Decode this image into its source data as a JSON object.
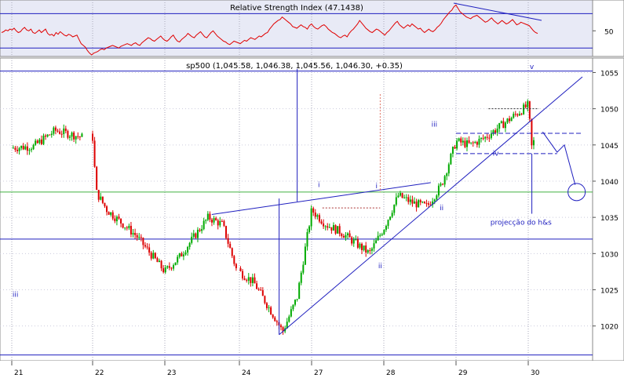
{
  "chart_data": [
    {
      "type": "line",
      "title": "Relative Strength Index (47.1438)",
      "ylim": [
        22,
        84
      ],
      "yticks": [
        50
      ],
      "hlines": [
        70,
        30
      ],
      "grid": true,
      "colors": {
        "line": "#e00000",
        "bg": "#e8eaf6",
        "hline": "#1f1fbf"
      },
      "series": [
        {
          "values": [
            48,
            49,
            51,
            50,
            52,
            51,
            53,
            50,
            48,
            49,
            52,
            54,
            51,
            50,
            52,
            48,
            47,
            49,
            51,
            48,
            50,
            52,
            47,
            45,
            46,
            44,
            48,
            46,
            49,
            47,
            45,
            44,
            46,
            45,
            43,
            44,
            45,
            40,
            35,
            33,
            31,
            27,
            24,
            22,
            24,
            25,
            26,
            28,
            29,
            28,
            30,
            31,
            32,
            33,
            32,
            31,
            30,
            32,
            33,
            34,
            35,
            34,
            33,
            35,
            36,
            34,
            33,
            36,
            38,
            40,
            42,
            41,
            39,
            38,
            40,
            42,
            44,
            41,
            39,
            38,
            40,
            43,
            45,
            41,
            38,
            37,
            40,
            42,
            44,
            47,
            45,
            43,
            42,
            45,
            47,
            49,
            46,
            43,
            42,
            45,
            48,
            50,
            47,
            44,
            42,
            40,
            38,
            37,
            35,
            34,
            36,
            38,
            37,
            36,
            35,
            37,
            39,
            38,
            40,
            42,
            41,
            40,
            42,
            44,
            43,
            45,
            47,
            48,
            52,
            55,
            58,
            60,
            62,
            63,
            66,
            64,
            62,
            60,
            58,
            55,
            54,
            53,
            55,
            57,
            55,
            54,
            52,
            56,
            58,
            55,
            53,
            52,
            54,
            56,
            57,
            55,
            52,
            50,
            48,
            47,
            45,
            43,
            42,
            44,
            45,
            43,
            47,
            50,
            52,
            55,
            58,
            62,
            59,
            56,
            53,
            51,
            49,
            48,
            50,
            52,
            51,
            49,
            47,
            45,
            48,
            50,
            53,
            56,
            59,
            61,
            57,
            55,
            53,
            55,
            57,
            55,
            58,
            56,
            54,
            52,
            53,
            50,
            48,
            50,
            52,
            50,
            49,
            51,
            54,
            56,
            59,
            63,
            66,
            69,
            72,
            74,
            78,
            80,
            76,
            72,
            70,
            68,
            66,
            65,
            64,
            66,
            67,
            68,
            66,
            64,
            62,
            60,
            61,
            63,
            65,
            62,
            60,
            58,
            60,
            62,
            60,
            58,
            59,
            61,
            63,
            60,
            57,
            58,
            60,
            59,
            58,
            57,
            56,
            53,
            50,
            48,
            47
          ]
        }
      ],
      "trendline_label": ""
    },
    {
      "type": "candlestick",
      "title": "sp500 (1,045.58, 1,046.38, 1,045.56, 1,046.30, +0.35)",
      "xlabel": "",
      "ylabel": "",
      "categories": [
        "21",
        "22",
        "23",
        "24",
        "27",
        "28",
        "29",
        "30"
      ],
      "ylim": [
        1015.2,
        1057.0
      ],
      "yticks": [
        1020,
        1025,
        1030,
        1035,
        1040,
        1045,
        1050,
        1055
      ],
      "grid": true,
      "colors": {
        "up": "#00aa00",
        "down": "#dd0000",
        "annotation": "#1f1fbf",
        "hline": "#1f1fbf",
        "green_line": "#40b040",
        "red_guide": "#e07060"
      },
      "ohlc_key_points": [
        {
          "x": 0,
          "close": 1044.6
        },
        {
          "x": 0.3,
          "close": 1044.8
        },
        {
          "x": 0.6,
          "close": 1047.0
        },
        {
          "x": 1.0,
          "close": 1046.0
        },
        {
          "x": 1.05,
          "close": 1038.5
        },
        {
          "x": 1.2,
          "close": 1036.0
        },
        {
          "x": 1.6,
          "close": 1032.5
        },
        {
          "x": 2.0,
          "close": 1027.5
        },
        {
          "x": 2.2,
          "close": 1029.5
        },
        {
          "x": 2.6,
          "close": 1035.0
        },
        {
          "x": 2.8,
          "close": 1034.0
        },
        {
          "x": 3.0,
          "close": 1027.5
        },
        {
          "x": 3.2,
          "close": 1026.0
        },
        {
          "x": 3.5,
          "close": 1021.0
        },
        {
          "x": 3.6,
          "close": 1019.2
        },
        {
          "x": 3.8,
          "close": 1024.0
        },
        {
          "x": 4.0,
          "close": 1036.0
        },
        {
          "x": 4.2,
          "close": 1034.0
        },
        {
          "x": 4.4,
          "close": 1033.0
        },
        {
          "x": 4.6,
          "close": 1031.5
        },
        {
          "x": 4.8,
          "close": 1030.0
        },
        {
          "x": 5.0,
          "close": 1033.5
        },
        {
          "x": 5.2,
          "close": 1038.0
        },
        {
          "x": 5.4,
          "close": 1037.0
        },
        {
          "x": 5.6,
          "close": 1036.5
        },
        {
          "x": 5.8,
          "close": 1039.5
        },
        {
          "x": 6.0,
          "close": 1045.5
        },
        {
          "x": 6.2,
          "close": 1045.0
        },
        {
          "x": 6.4,
          "close": 1046.0
        },
        {
          "x": 6.6,
          "close": 1047.5
        },
        {
          "x": 6.8,
          "close": 1049.0
        },
        {
          "x": 7.0,
          "close": 1050.5
        },
        {
          "x": 7.05,
          "close": 1044.5
        },
        {
          "x": 7.1,
          "close": 1046.3
        }
      ],
      "hlines": [
        {
          "y": 1038.5,
          "style": "green"
        },
        {
          "y": 1032.0,
          "style": "blue"
        },
        {
          "y": 1016.0,
          "style": "blue"
        },
        {
          "y": 1055.2,
          "style": "blue"
        }
      ],
      "annotations": [
        {
          "text": "i",
          "x": 4.1,
          "y": 1039.2
        },
        {
          "text": "i",
          "x": 4.9,
          "y": 1039.0
        },
        {
          "text": "ii",
          "x": 4.95,
          "y": 1028.0
        },
        {
          "text": "ii",
          "x": 5.8,
          "y": 1036.0
        },
        {
          "text": "iii",
          "x": 0.05,
          "y": 1024.0
        },
        {
          "text": "iii",
          "x": 5.7,
          "y": 1047.5
        },
        {
          "text": "iv",
          "x": 6.55,
          "y": 1043.5
        },
        {
          "text": "v",
          "x": 7.05,
          "y": 1055.5
        },
        {
          "text": "projecção do h&s",
          "x": 6.9,
          "y": 1034.0
        }
      ]
    }
  ]
}
